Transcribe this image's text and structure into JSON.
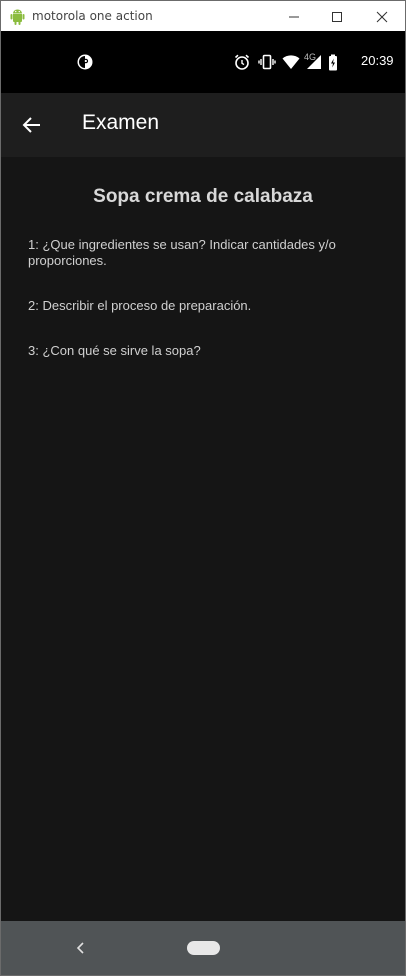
{
  "window": {
    "title": "motorola one action",
    "icons": [
      "android-icon",
      "minimize-icon",
      "maximize-icon",
      "close-icon"
    ]
  },
  "status_bar": {
    "time": "20:39",
    "network_label": "4G",
    "icons": [
      "notification-app-icon",
      "alarm-icon",
      "vibrate-icon",
      "wifi-icon",
      "signal-icon",
      "battery-icon"
    ]
  },
  "app_bar": {
    "title": "Examen",
    "back_icon": "arrow-back-icon"
  },
  "exam": {
    "title": "Sopa crema de calabaza",
    "questions": [
      "1: ¿Que ingredientes se usan? Indicar cantidades y/o proporciones.",
      "2: Describir el proceso de preparación.",
      "3: ¿Con qué se sirve la sopa?"
    ]
  },
  "nav_bar": {
    "icons": [
      "nav-back-icon",
      "home-pill-icon"
    ]
  },
  "colors": {
    "background": "#151515",
    "app_bar": "#1e1e1e",
    "status_bar": "#000000",
    "nav_bar": "#505456",
    "android_green": "#8bbc3f"
  }
}
